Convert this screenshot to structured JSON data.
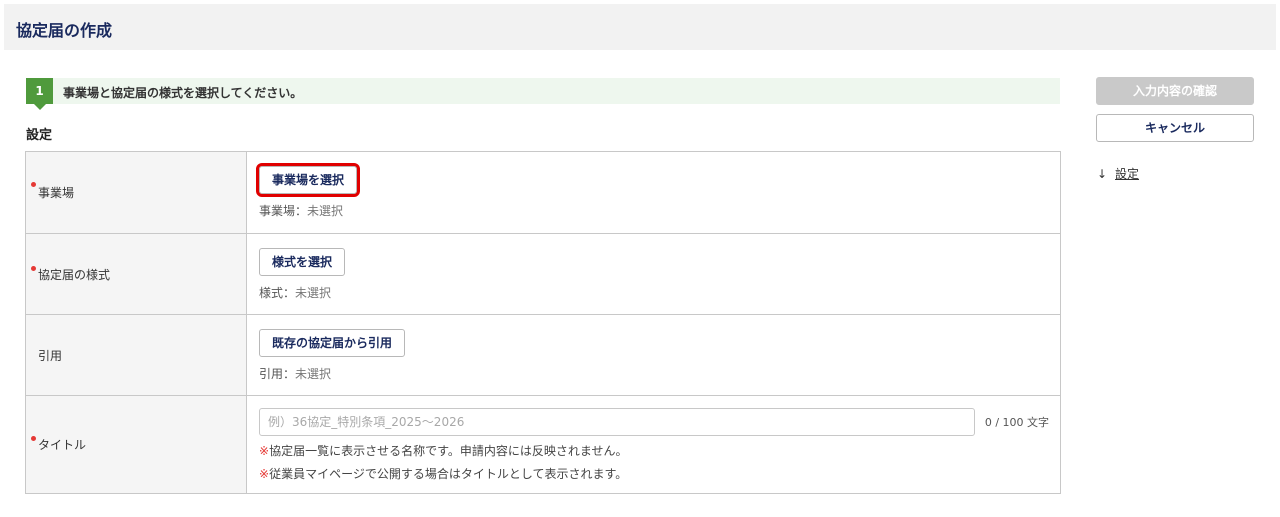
{
  "page": {
    "title": "協定届の作成"
  },
  "step": {
    "number": "1",
    "text": "事業場と協定届の様式を選択してください。"
  },
  "section": {
    "title": "設定"
  },
  "rows": {
    "workplace": {
      "label": "事業場",
      "button": "事業場を選択",
      "status_label": "事業場：",
      "status_value": "未選択"
    },
    "format": {
      "label": "協定届の様式",
      "button": "様式を選択",
      "status_label": "様式：",
      "status_value": "未選択"
    },
    "citation": {
      "label": "引用",
      "button": "既存の協定届から引用",
      "status_label": "引用：",
      "status_value": "未選択"
    },
    "title": {
      "label": "タイトル",
      "placeholder": "例）36協定_特別条項_2025〜2026",
      "value": "",
      "char_count": "0 / 100 文字",
      "note_mark": "※",
      "note1": "協定届一覧に表示させる名称です。申請内容には反映されません。",
      "note2": "従業員マイページで公開する場合はタイトルとして表示されます。"
    }
  },
  "sidebar": {
    "confirm_label": "入力内容の確認",
    "cancel_label": "キャンセル",
    "anchor_arrow": "↓",
    "anchor_label": "設定"
  },
  "colors": {
    "accent": "#1a2a5e",
    "step_green": "#4f9a3c",
    "required_red": "#e53935",
    "highlight_red": "#e00000"
  }
}
